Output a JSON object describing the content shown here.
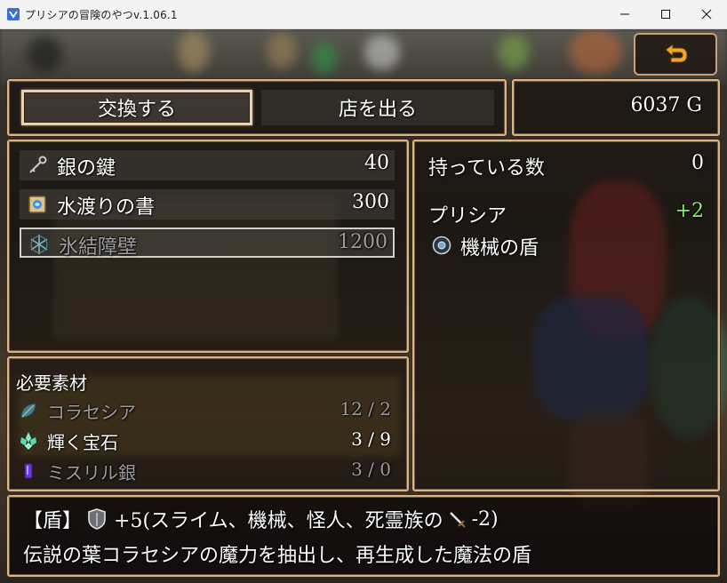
{
  "window": {
    "title": "プリシアの冒険のやつv.1.06.1"
  },
  "commands": {
    "exchange": "交換する",
    "leave": "店を出る"
  },
  "gold": "6037 G",
  "items": [
    {
      "name": "銀の鍵",
      "price": "40",
      "icon": "key-icon",
      "enabled": true
    },
    {
      "name": "水渡りの書",
      "price": "300",
      "icon": "scroll-icon",
      "enabled": true
    },
    {
      "name": "氷結障壁",
      "price": "1200",
      "icon": "ice-barrier-icon",
      "enabled": false
    }
  ],
  "status": {
    "owned_label": "持っている数",
    "owned_count": "0",
    "character": "プリシア",
    "bonus": "+2",
    "equipment": "機械の盾"
  },
  "materials": {
    "title": "必要素材",
    "list": [
      {
        "name": "コラセシア",
        "qty": "12 / 2",
        "icon": "leaf-icon",
        "enough": false
      },
      {
        "name": "輝く宝石",
        "qty": "3 / 9",
        "icon": "gem-icon",
        "enough": true
      },
      {
        "name": "ミスリル銀",
        "qty": "3 / 0",
        "icon": "mithril-icon",
        "enough": false
      }
    ]
  },
  "description": {
    "category": "【盾】",
    "effect_prefix": "+5(スライム、機械、怪人、死霊族の",
    "effect_suffix": "-2)",
    "text": "伝説の葉コラセシアの魔力を抽出し、再生成した魔法の盾"
  },
  "colors": {
    "frame": "#d9b487",
    "bonus_green": "#86f06a",
    "disabled_text": "#9c9ca0"
  }
}
